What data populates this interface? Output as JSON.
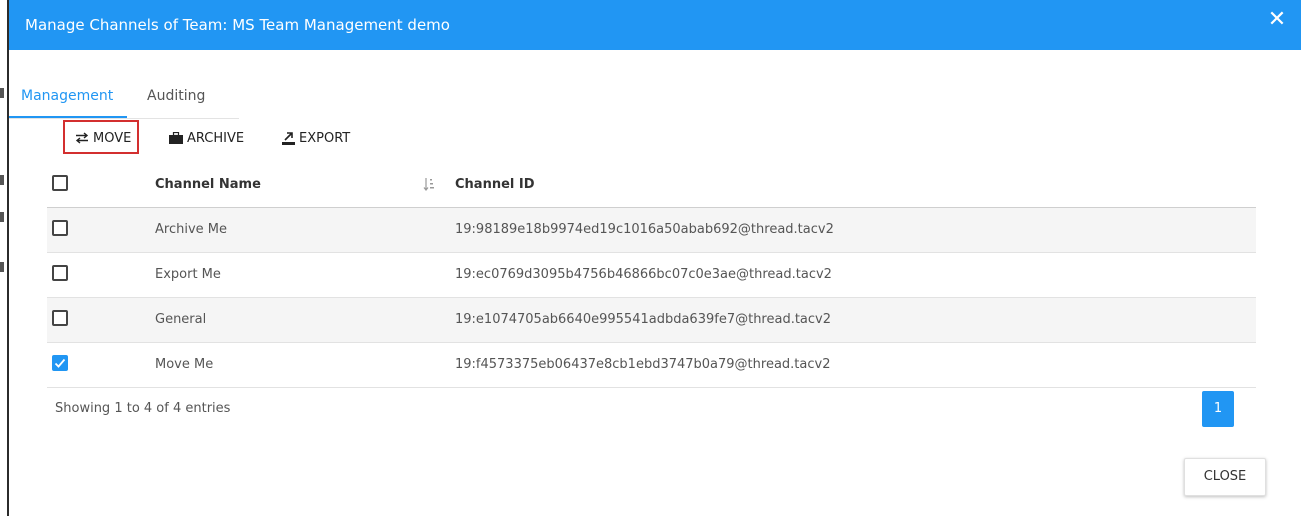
{
  "dialog": {
    "title": "Manage Channels of Team: MS Team Management demo",
    "close_glyph": "✕"
  },
  "tabs": [
    {
      "label": "Management",
      "active": true
    },
    {
      "label": "Auditing",
      "active": false
    }
  ],
  "toolbar": {
    "move_label": "MOVE",
    "archive_label": "ARCHIVE",
    "export_label": "EXPORT"
  },
  "table": {
    "headers": {
      "name": "Channel Name",
      "id": "Channel ID"
    },
    "rows": [
      {
        "name": "Archive Me",
        "id": "19:98189e18b9974ed19c1016a50abab692@thread.tacv2",
        "checked": false
      },
      {
        "name": "Export Me",
        "id": "19:ec0769d3095b4756b46866bc07c0e3ae@thread.tacv2",
        "checked": false
      },
      {
        "name": "General",
        "id": "19:e1074705ab6640e995541adbda639fe7@thread.tacv2",
        "checked": false
      },
      {
        "name": "Move Me",
        "id": "19:f4573375eb06437e8cb1ebd3747b0a79@thread.tacv2",
        "checked": true
      }
    ]
  },
  "footer": {
    "info": "Showing 1 to 4 of 4 entries",
    "page": "1",
    "close_label": "CLOSE"
  },
  "colors": {
    "accent": "#2196f3",
    "highlight_border": "#d32f2f"
  },
  "icons": {
    "move": "swap-arrows-icon",
    "archive": "briefcase-icon",
    "export": "export-icon",
    "sort": "sort-icon",
    "close": "close-icon"
  }
}
